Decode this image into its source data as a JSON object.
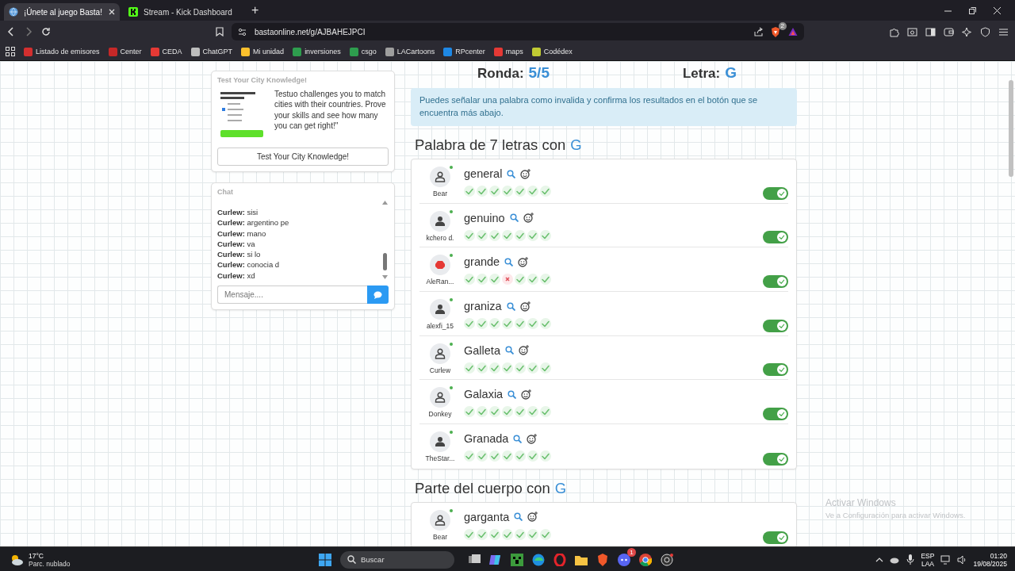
{
  "browser": {
    "tabs": [
      {
        "title": "¡Únete al juego Basta!",
        "selected": true
      },
      {
        "title": "Stream - Kick Dashboard",
        "selected": false
      }
    ],
    "new_tab": "+",
    "url": "bastaonline.net/g/AJBAHEJPCI",
    "shields_count": "2",
    "bookmarks": [
      {
        "label": "Listado de emisores",
        "color": "#d32f2f"
      },
      {
        "label": "Center",
        "color": "#c62828"
      },
      {
        "label": "CEDA",
        "color": "#e53935"
      },
      {
        "label": "ChatGPT",
        "color": "#bdbdbd"
      },
      {
        "label": "Mi unidad",
        "color": "#fbc02d"
      },
      {
        "label": "inversiones",
        "color": "#2e9d4e"
      },
      {
        "label": "csgo",
        "color": "#2e9d4e"
      },
      {
        "label": "LACartoons",
        "color": "#9e9e9e"
      },
      {
        "label": "RPcenter",
        "color": "#1e88e5"
      },
      {
        "label": "maps",
        "color": "#e53935"
      },
      {
        "label": "Codédex",
        "color": "#c0ca33"
      }
    ]
  },
  "ad": {
    "title": "Test Your City Knowledge!",
    "text": "Testuo challenges you to match cities with their countries. Prove your skills and see how many you can get right!\"",
    "button": "Test Your City Knowledge!"
  },
  "chat": {
    "title": "Chat",
    "messages": [
      {
        "user": "Curlew:",
        "text": "sisi"
      },
      {
        "user": "Curlew:",
        "text": "argentino pe"
      },
      {
        "user": "Curlew:",
        "text": "mano"
      },
      {
        "user": "Curlew:",
        "text": "va"
      },
      {
        "user": "Curlew:",
        "text": "si lo"
      },
      {
        "user": "Curlew:",
        "text": "conocia d"
      },
      {
        "user": "Curlew:",
        "text": "xd"
      }
    ],
    "placeholder": "Mensaje...."
  },
  "game": {
    "round_label": "Ronda:",
    "round": "5/5",
    "letter_label": "Letra:",
    "letter": "G",
    "notice": "Puedes señalar una palabra como invalida y confirma los resultados en el botón que se encuentra más abajo.",
    "sections": [
      {
        "title": "Palabra de 7 letras con",
        "letter": "G",
        "answers": [
          {
            "player": "Bear",
            "kind": "outline",
            "online": true,
            "word": "general",
            "votes": [
              true,
              true,
              true,
              true,
              true,
              true,
              true
            ],
            "accepted": true
          },
          {
            "player": "kchero d.",
            "kind": "filled",
            "online": true,
            "word": "genuino",
            "votes": [
              true,
              true,
              true,
              true,
              true,
              true,
              true
            ],
            "accepted": true
          },
          {
            "player": "AleRan...",
            "kind": "stop",
            "online": true,
            "word": "grande",
            "votes": [
              true,
              true,
              true,
              false,
              true,
              true,
              true
            ],
            "accepted": true
          },
          {
            "player": "alexfi_15",
            "kind": "filled",
            "online": true,
            "word": "graniza",
            "votes": [
              true,
              true,
              true,
              true,
              true,
              true,
              true
            ],
            "accepted": true
          },
          {
            "player": "Curlew",
            "kind": "outline",
            "online": true,
            "word": "Galleta",
            "votes": [
              true,
              true,
              true,
              true,
              true,
              true,
              true
            ],
            "accepted": true
          },
          {
            "player": "Donkey",
            "kind": "outline",
            "online": true,
            "word": "Galaxia",
            "votes": [
              true,
              true,
              true,
              true,
              true,
              true,
              true
            ],
            "accepted": true
          },
          {
            "player": "TheStar...",
            "kind": "filled",
            "online": true,
            "word": "Granada",
            "votes": [
              true,
              true,
              true,
              true,
              true,
              true,
              true
            ],
            "accepted": true
          }
        ]
      },
      {
        "title": "Parte del cuerpo con",
        "letter": "G",
        "answers": [
          {
            "player": "Bear",
            "kind": "outline",
            "online": true,
            "word": "garganta",
            "votes": [
              true,
              true,
              true,
              true,
              true,
              true,
              true
            ],
            "accepted": true
          }
        ]
      }
    ]
  },
  "windows_notice": {
    "title": "Activar Windows",
    "text": "Ve a Configuración para activar Windows."
  },
  "taskbar": {
    "temperature": "17°C",
    "weather": "Parc. nublado",
    "search_placeholder": "Buscar",
    "discord_badge": "1",
    "language": "ESP",
    "layout": "LAA",
    "time": "01:20",
    "date": "19/08/2025"
  }
}
